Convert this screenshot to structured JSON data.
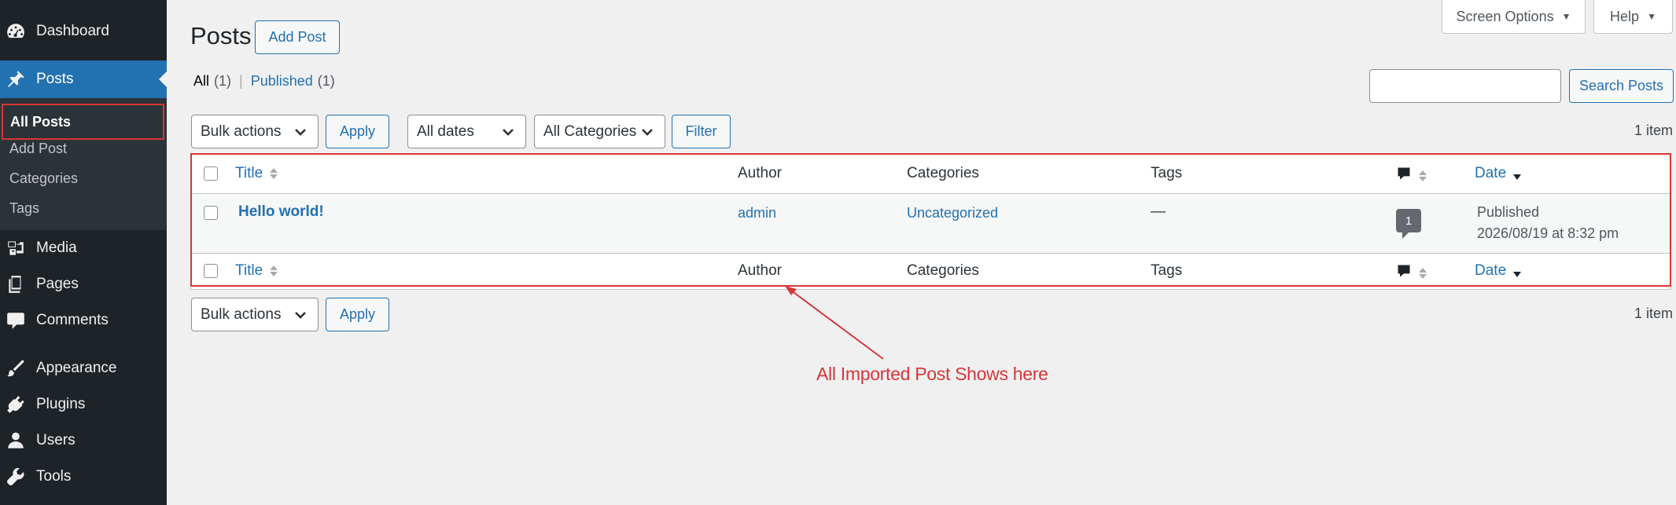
{
  "sidebar": {
    "dashboard": "Dashboard",
    "posts": "Posts",
    "submenu": {
      "all_posts": "All Posts",
      "add_post": "Add Post",
      "categories": "Categories",
      "tags": "Tags"
    },
    "media": "Media",
    "pages": "Pages",
    "comments": "Comments",
    "appearance": "Appearance",
    "plugins": "Plugins",
    "users": "Users",
    "tools": "Tools"
  },
  "header": {
    "screen_options": "Screen Options",
    "help": "Help",
    "title": "Posts",
    "add_post": "Add Post"
  },
  "views": {
    "all_label": "All",
    "all_count": "(1)",
    "published_label": "Published",
    "published_count": "(1)"
  },
  "search": {
    "value": "",
    "button": "Search Posts"
  },
  "tablenav_top": {
    "bulk_actions": "Bulk actions",
    "apply": "Apply",
    "dates": "All dates",
    "categories": "All Categories",
    "filter": "Filter",
    "items": "1 item"
  },
  "table": {
    "columns": {
      "title": "Title",
      "author": "Author",
      "categories": "Categories",
      "tags": "Tags",
      "date": "Date"
    },
    "rows": [
      {
        "title": "Hello world!",
        "author": "admin",
        "categories": "Uncategorized",
        "tags": "—",
        "comments": "1",
        "status": "Published",
        "date": "2026/08/19 at 8:32 pm"
      }
    ]
  },
  "tablenav_bottom": {
    "bulk_actions": "Bulk actions",
    "apply": "Apply",
    "items": "1 item"
  },
  "annotation": {
    "text": "All Imported Post Shows here",
    "color": "#d63638"
  },
  "colors": {
    "sidebar_bg": "#1d2327",
    "accent": "#2271b1",
    "page_bg": "#f0f0f1"
  }
}
